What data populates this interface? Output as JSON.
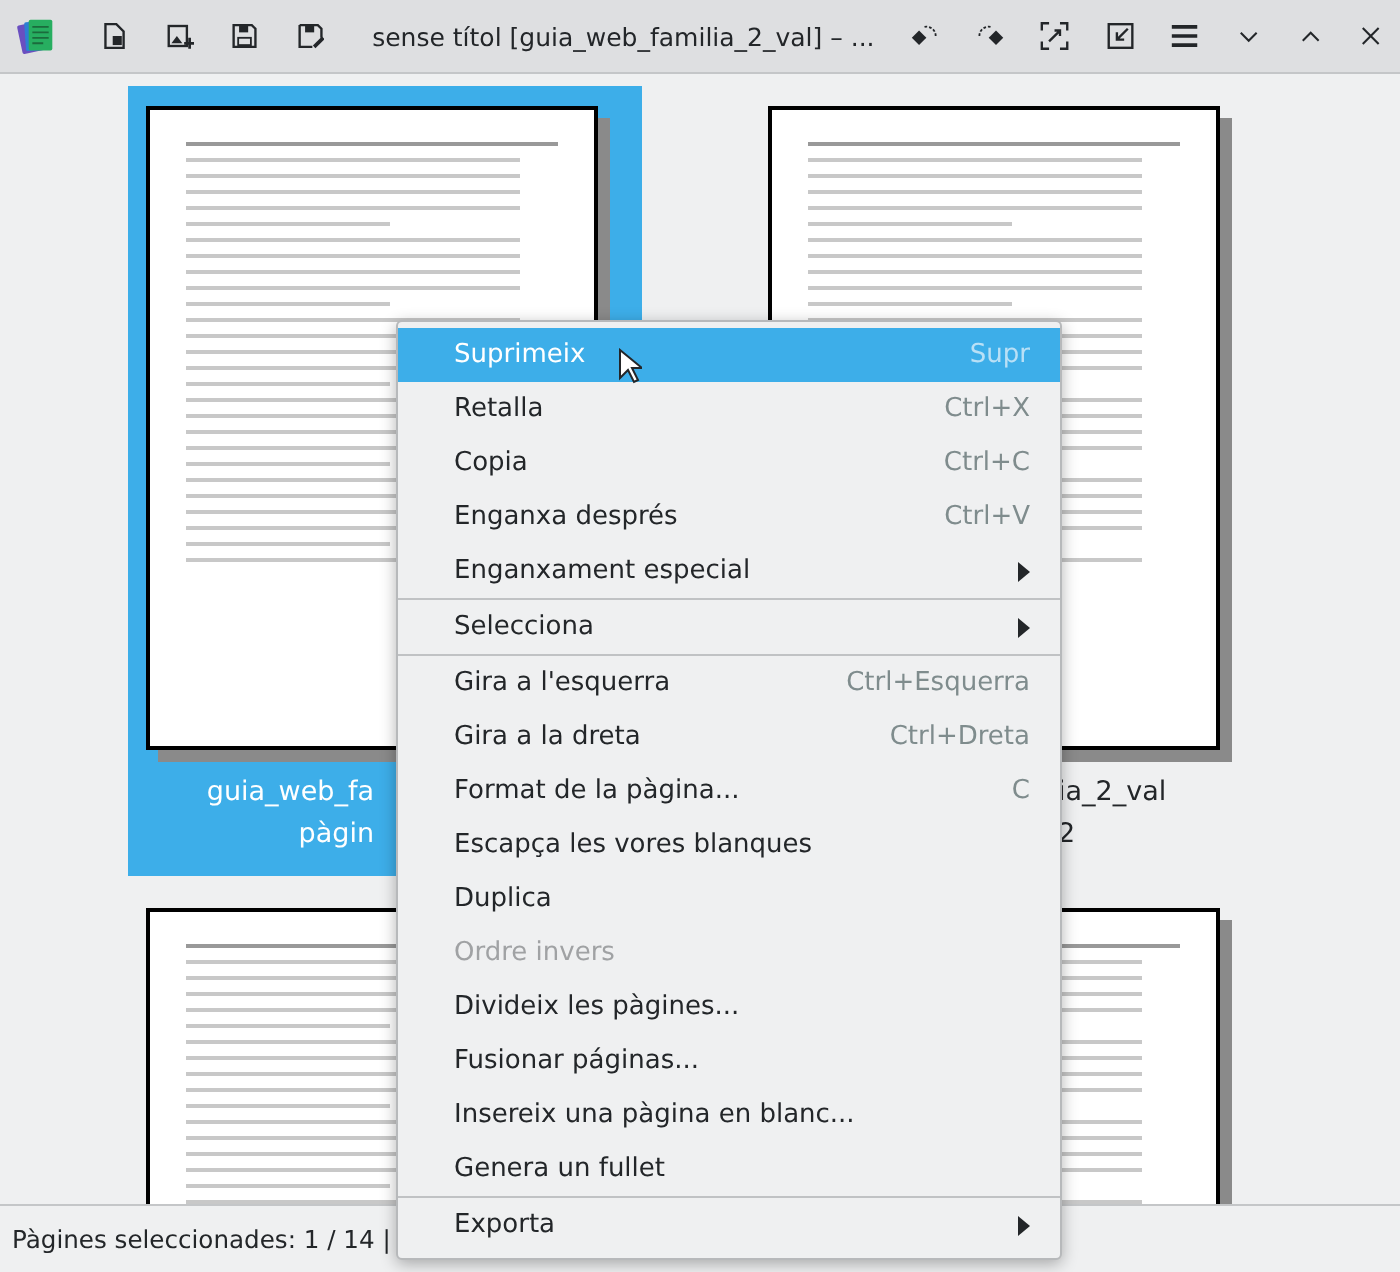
{
  "window": {
    "title": "sense títol [guia_web_familia_2_val] – ..."
  },
  "pages": [
    {
      "selected": true,
      "caption_lines": [
        "guia_web_fa",
        "pàgin"
      ]
    },
    {
      "selected": false,
      "caption_lines": [
        "ia_2_val",
        "2"
      ]
    },
    {
      "selected": false
    },
    {
      "selected": false
    }
  ],
  "context_menu": {
    "sections": [
      [
        {
          "label": "Suprimeix",
          "shortcut": "Supr",
          "submenu": false,
          "disabled": false,
          "selected": true
        },
        {
          "label": "Retalla",
          "shortcut": "Ctrl+X",
          "submenu": false,
          "disabled": false,
          "selected": false
        },
        {
          "label": "Copia",
          "shortcut": "Ctrl+C",
          "submenu": false,
          "disabled": false,
          "selected": false
        },
        {
          "label": "Enganxa després",
          "shortcut": "Ctrl+V",
          "submenu": false,
          "disabled": false,
          "selected": false
        },
        {
          "label": "Enganxament especial",
          "submenu": true,
          "disabled": false,
          "selected": false
        }
      ],
      [
        {
          "label": "Selecciona",
          "submenu": true,
          "disabled": false,
          "selected": false
        }
      ],
      [
        {
          "label": "Gira a l'esquerra",
          "shortcut": "Ctrl+Esquerra",
          "submenu": false,
          "disabled": false,
          "selected": false
        },
        {
          "label": "Gira a la dreta",
          "shortcut": "Ctrl+Dreta",
          "submenu": false,
          "disabled": false,
          "selected": false
        },
        {
          "label": "Format de la pàgina...",
          "shortcut": "C",
          "submenu": false,
          "disabled": false,
          "selected": false
        },
        {
          "label": "Escapça les vores blanques",
          "submenu": false,
          "disabled": false,
          "selected": false
        },
        {
          "label": "Duplica",
          "submenu": false,
          "disabled": false,
          "selected": false
        },
        {
          "label": "Ordre invers",
          "submenu": false,
          "disabled": true,
          "selected": false
        },
        {
          "label": "Divideix les pàgines...",
          "submenu": false,
          "disabled": false,
          "selected": false
        },
        {
          "label": "Fusionar páginas...",
          "submenu": false,
          "disabled": false,
          "selected": false
        },
        {
          "label": "Insereix una pàgina en blanc...",
          "submenu": false,
          "disabled": false,
          "selected": false
        },
        {
          "label": "Genera un fullet",
          "submenu": false,
          "disabled": false,
          "selected": false
        }
      ],
      [
        {
          "label": "Exporta",
          "submenu": true,
          "disabled": false,
          "selected": false
        }
      ]
    ]
  },
  "status_bar": {
    "text": "Pàgines seleccionades: 1 / 14 |"
  }
}
